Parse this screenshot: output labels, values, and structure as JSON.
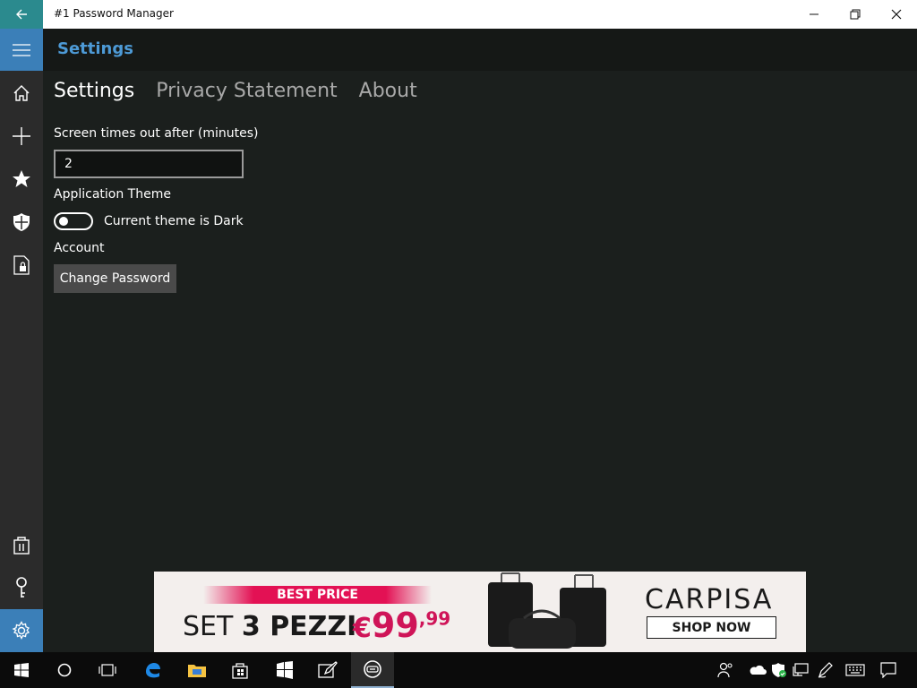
{
  "window": {
    "title": "#1 Password Manager"
  },
  "header": {
    "title": "Settings"
  },
  "tabs": [
    {
      "label": "Settings"
    },
    {
      "label": "Privacy Statement"
    },
    {
      "label": "About"
    }
  ],
  "settings": {
    "timeout_label": "Screen times out after (minutes)",
    "timeout_value": "2",
    "theme_label": "Application Theme",
    "theme_toggle_text": "Current theme is Dark",
    "theme_toggle_on": false,
    "account_label": "Account",
    "change_password_label": "Change Password"
  },
  "ad": {
    "badge": "BEST PRICE",
    "set_text": "SET",
    "set_bold": "3 PEZZI",
    "price_currency": "€",
    "price_int": "99",
    "price_dec": ",99",
    "brand": "CARPISA",
    "cta": "SHOP NOW"
  },
  "colors": {
    "accent": "#3b7fb8",
    "back_button": "#2b8a8e",
    "header_title": "#4d9ad6",
    "ad_pink": "#e31154"
  },
  "icons": {
    "sidebar": [
      "home-icon",
      "add-icon",
      "star-icon",
      "shield-icon",
      "lock-document-icon",
      "store-bag-icon",
      "key-icon",
      "gear-icon"
    ],
    "taskbar": [
      "windows-start-icon",
      "cortana-icon",
      "task-view-icon",
      "edge-icon",
      "file-explorer-icon",
      "store-icon",
      "windows-app-icon",
      "sketch-icon",
      "password-manager-icon"
    ],
    "tray": [
      "people-icon",
      "onedrive-icon",
      "defender-icon",
      "network-icon",
      "pen-icon",
      "keyboard-icon",
      "action-center-icon"
    ]
  }
}
